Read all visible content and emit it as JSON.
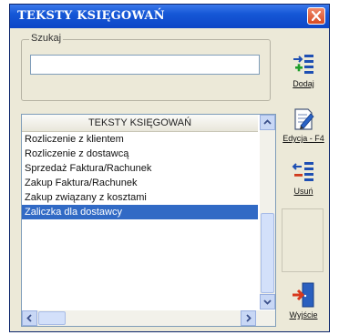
{
  "window": {
    "title": "TEKSTY KSIĘGOWAŃ"
  },
  "search": {
    "legend": "Szukaj",
    "value": ""
  },
  "list": {
    "header": "TEKSTY KSIĘGOWAŃ",
    "items": [
      "Rozliczenie  z klientem",
      "Rozliczenie z dostawcą",
      "Sprzedaż Faktura/Rachunek",
      "Zakup Faktura/Rachunek",
      "Zakup związany z kosztami",
      "Zaliczka dla dostawcy"
    ],
    "selected_index": 5
  },
  "buttons": {
    "add_label": "Dodaj",
    "edit_label": "Edycja - F4",
    "delete_label": "Usuń",
    "exit_label": "Wyjście"
  },
  "colors": {
    "titlebar": "#0d46c7",
    "selection": "#316ac5",
    "add_green": "#1f9e2a",
    "delete_red": "#d03a1c",
    "icon_blue": "#1e4fb3",
    "exit_door": "#2a5fbf",
    "exit_arrow": "#d8391e"
  },
  "icons": {
    "close": "close-icon",
    "add": "add-list-icon",
    "edit": "edit-document-icon",
    "delete": "delete-list-icon",
    "exit": "exit-door-icon"
  }
}
